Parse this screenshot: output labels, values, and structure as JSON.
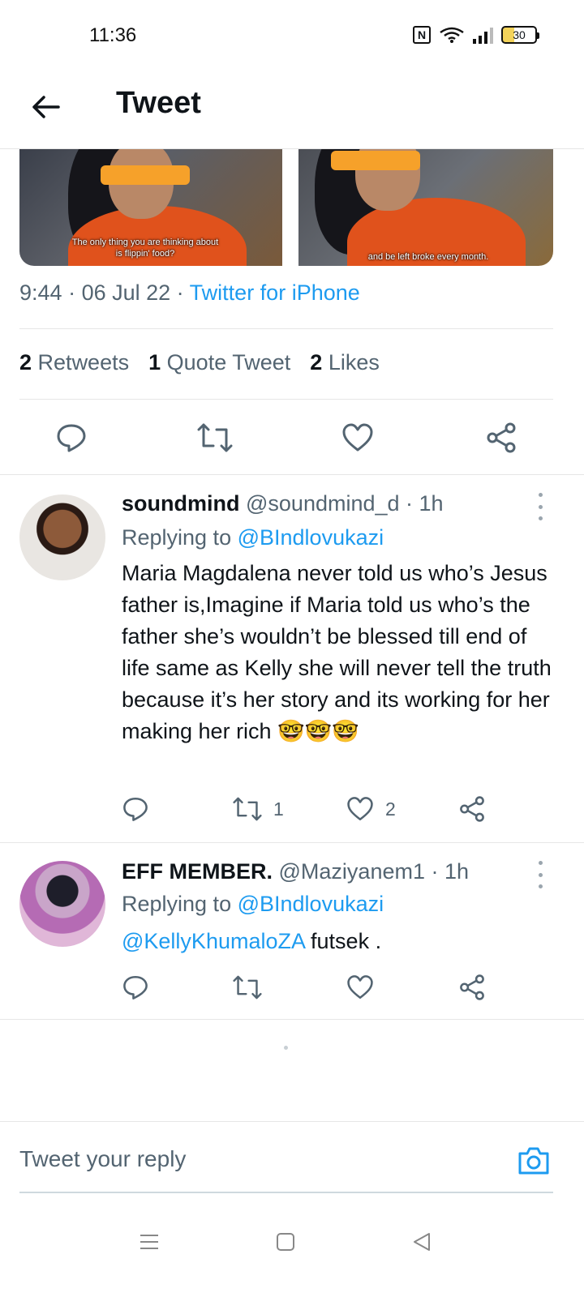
{
  "status_bar": {
    "time": "11:36",
    "battery": "30"
  },
  "header": {
    "title": "Tweet"
  },
  "media": {
    "left_caption": "The only thing you are thinking about is flippin' food?",
    "right_caption": "and be left broke every month."
  },
  "tweet": {
    "time": "9:44",
    "date": "06 Jul 22",
    "source": "Twitter for iPhone",
    "retweets_count": "2",
    "retweets_label": "Retweets",
    "quotes_count": "1",
    "quotes_label": "Quote Tweet",
    "likes_count": "2",
    "likes_label": "Likes"
  },
  "replies": [
    {
      "name": "soundmind",
      "handle": "@soundmind_d",
      "age": "1h",
      "replying_prefix": "Replying to",
      "replying_to": "@BIndlovukazi",
      "text": "Maria Magdalena never told us who’s Jesus father is,Imagine if Maria told us who’s the father she’s wouldn’t be blessed till end of life same as Kelly she will never tell the truth because it’s her story and its working for her making her rich 🤓🤓🤓",
      "retweets": "1",
      "likes": "2"
    },
    {
      "name": "EFF MEMBER.",
      "handle": "@Maziyanem1",
      "age": "1h",
      "replying_prefix": "Replying to",
      "replying_to": "@BIndlovukazi",
      "mention": "@KellyKhumaloZA",
      "text": "futsek ."
    }
  ],
  "composer": {
    "placeholder": "Tweet your reply"
  },
  "colors": {
    "link": "#1d9bf0",
    "muted": "#536471",
    "text": "#0f1419"
  },
  "icons": [
    "back-arrow-icon",
    "reply-icon",
    "retweet-icon",
    "heart-icon",
    "share-icon",
    "more-icon",
    "camera-icon",
    "menu-icon",
    "home-icon",
    "back-triangle-icon"
  ]
}
